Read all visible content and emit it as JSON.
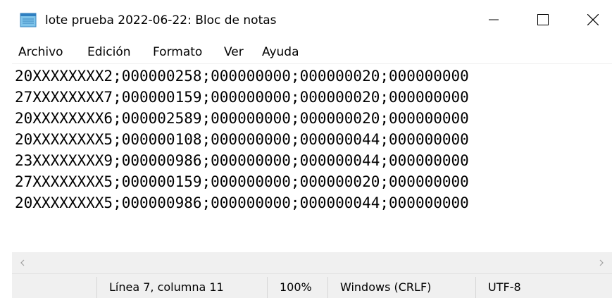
{
  "window": {
    "title": "lote prueba 2022-06-22: Bloc de notas"
  },
  "title_buttons": {
    "minimize_icon": "minimize-icon",
    "maximize_icon": "maximize-icon",
    "close_icon": "close-icon"
  },
  "menu": {
    "items": [
      "Archivo",
      "Edición",
      "Formato",
      "Ver",
      "Ayuda"
    ]
  },
  "editor": {
    "lines": [
      "20XXXXXXXX2;000000258;000000000;000000020;000000000",
      "27XXXXXXXX7;000000159;000000000;000000020;000000000",
      "20XXXXXXXX6;000002589;000000000;000000020;000000000",
      "20XXXXXXXX5;000000108;000000000;000000044;000000000",
      "23XXXXXXXX9;000000986;000000000;000000044;000000000",
      "27XXXXXXXX5;000000159;000000000;000000020;000000000",
      "20XXXXXXXX5;000000986;000000000;000000044;000000000"
    ],
    "caret_line": 7,
    "caret_column": 11
  },
  "status": {
    "position": "Línea 7, columna 11",
    "zoom": "100%",
    "line_ending": "Windows (CRLF)",
    "encoding": "UTF-8"
  },
  "colors": {
    "chrome": "#f0f0f0",
    "background": "#ffffff",
    "text": "#000000",
    "scroll_arrow": "#a0a0a0"
  }
}
